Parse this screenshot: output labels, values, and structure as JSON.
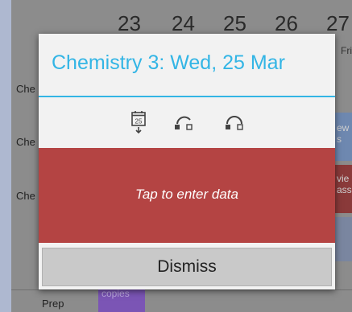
{
  "calendar": {
    "dates": [
      "23",
      "24",
      "25",
      "26",
      "27"
    ],
    "days_visible": [
      "Fri"
    ],
    "rows": [
      {
        "label": "Che"
      },
      {
        "label": "Che"
      },
      {
        "label": "Che"
      },
      {
        "label": "Prep"
      }
    ],
    "cells": {
      "col5_row2": "ew\ns",
      "col5_row3": "vie\nass",
      "prep_cell": "copies"
    }
  },
  "dialog": {
    "title": "Chemistry 3: Wed, 25 Mar",
    "icons": {
      "calendar_day": "25",
      "calendar": "calendar-download-icon",
      "arc_left": "undo-arc-icon",
      "arc_right": "redo-arc-icon"
    },
    "data_prompt": "Tap to enter data",
    "dismiss_label": "Dismiss"
  },
  "colors": {
    "accent": "#33b5e5",
    "data_area": "#b44443",
    "prep_cell": "#7b55b5",
    "row_red": "#8a3a3a",
    "row_blue": "#6e88b0"
  }
}
